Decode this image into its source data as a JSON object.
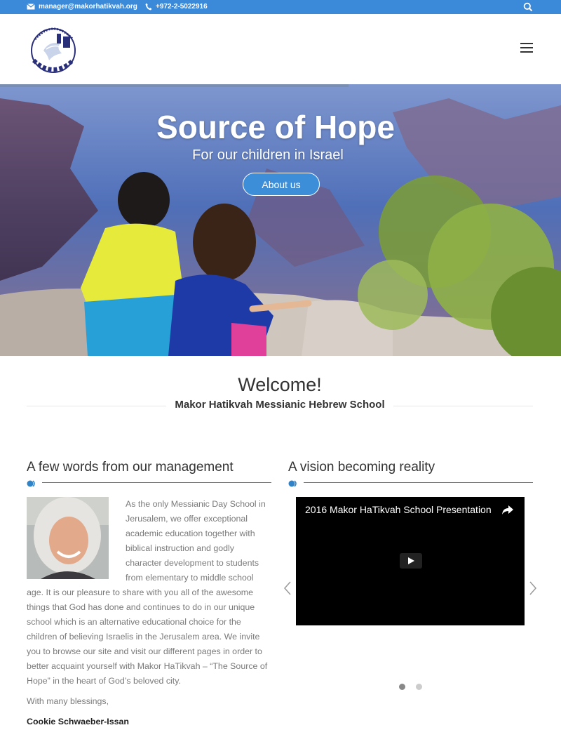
{
  "topbar": {
    "email": "manager@makorhatikvah.org",
    "phone": "+972-2-5022916",
    "icons": [
      "mail-icon",
      "phone-icon",
      "search-icon"
    ]
  },
  "header": {
    "logo_alt": "Makor HaTikvah logo",
    "menu_icon": "hamburger-icon"
  },
  "hero": {
    "title": "Source of Hope",
    "subtitle": "For our children in Israel",
    "button_label": "About us"
  },
  "welcome": {
    "title": "Welcome!",
    "subtitle": "Makor Hatikvah Messianic Hebrew School"
  },
  "management": {
    "title": "A few words from our management",
    "body": "As the only Messianic Day School in Jerusalem, we offer exceptional academic education together with biblical instruction and godly character development to students from elementary to middle school age. It is our pleasure to share with you all of the awesome things that God has done and continues to do in our unique school which is an alternative educational choice for the children of believing Israelis in the Jerusalem area. We invite you to browse our site and visit our different pages in order to better acquaint yourself with Makor HaTikvah – “The Source of Hope” in the heart of God’s beloved city.",
    "closing": "With many blessings,",
    "signature": "Cookie Schwaeber-Issan"
  },
  "vision": {
    "title": "A vision becoming reality",
    "video_title": "2016 Makor HaTikvah School Presentation",
    "slides_count": 2,
    "active_slide": 1
  },
  "colors": {
    "accent": "#3b89d9",
    "rule": "#2f83c6",
    "text_muted": "#7a7a7a"
  }
}
